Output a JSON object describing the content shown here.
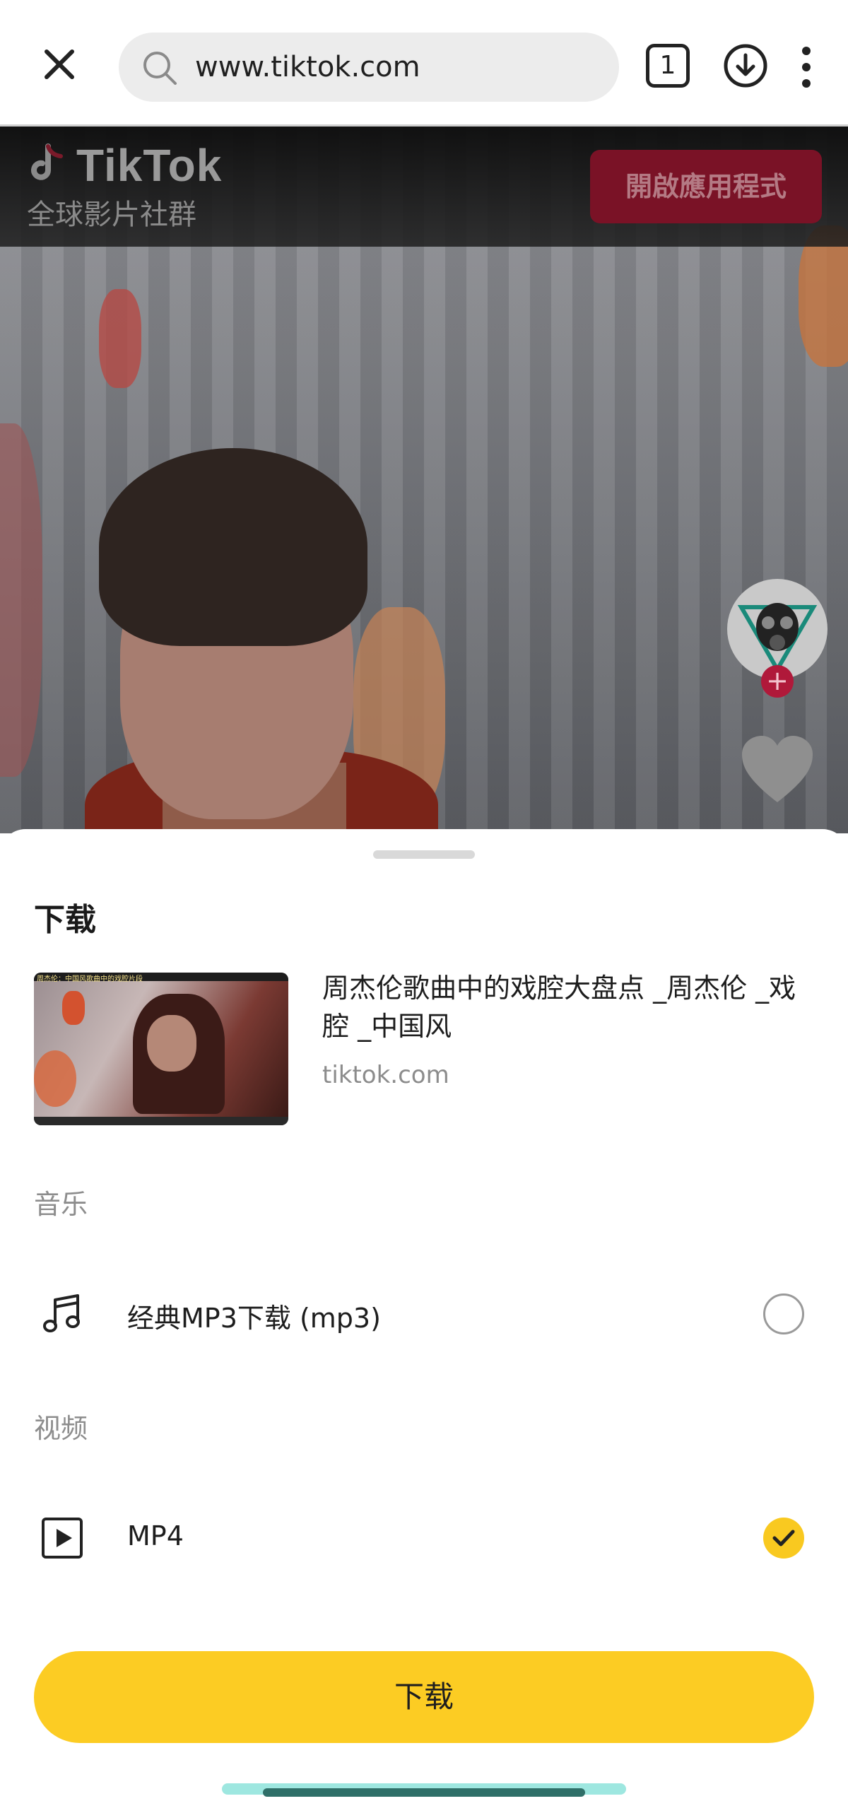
{
  "browser": {
    "url": "www.tiktok.com",
    "tab_count": "1",
    "icons": [
      "close-icon",
      "search-icon",
      "download-icon",
      "more-vert-icon"
    ]
  },
  "tiktok": {
    "logo_text": "TikTok",
    "tagline": "全球影片社群",
    "open_app_label": "開啟應用程式",
    "colors": {
      "open_app_bg": "#7a1226",
      "follow_badge": "#b0193a"
    }
  },
  "sheet": {
    "title": "下载",
    "video": {
      "title": "周杰伦歌曲中的戏腔大盘点 _周杰伦 _戏腔 _中国风",
      "source": "tiktok.com",
      "thumbnail_caption": "周杰伦：中国风歌曲中的戏腔片段"
    },
    "sections": {
      "music_label": "音乐",
      "video_label": "视频"
    },
    "options": {
      "mp3": {
        "label": "经典MP3下载 (mp3)",
        "selected": false,
        "icon": "music-note-icon"
      },
      "mp4": {
        "label": "MP4",
        "selected": true,
        "icon": "play-box-icon"
      }
    },
    "download_button": "下载",
    "colors": {
      "accent": "#fccc23",
      "check_bg": "#f9c920"
    }
  }
}
